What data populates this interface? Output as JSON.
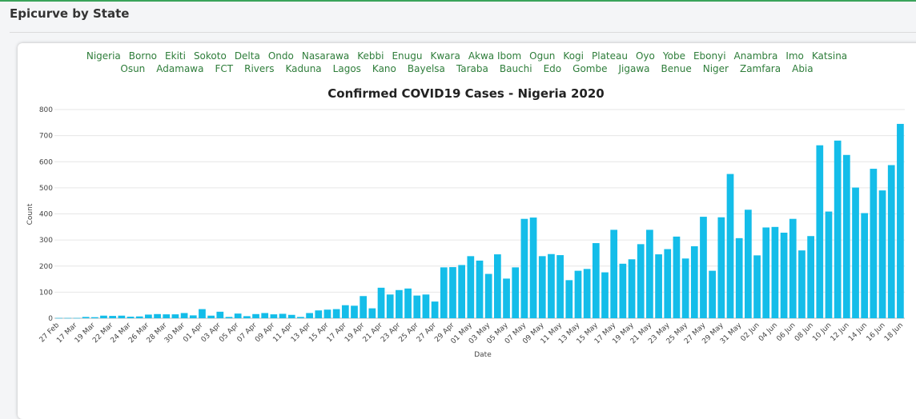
{
  "header": {
    "title": "Epicurve by State"
  },
  "state_filter": {
    "row1": [
      "Nigeria",
      "Borno",
      "Ekiti",
      "Sokoto",
      "Delta",
      "Ondo",
      "Nasarawa",
      "Kebbi",
      "Enugu",
      "Kwara",
      "Akwa Ibom",
      "Ogun",
      "Kogi",
      "Plateau",
      "Oyo",
      "Yobe",
      "Ebonyi",
      "Anambra",
      "Imo",
      "Katsina"
    ],
    "row2": [
      "Osun",
      "Adamawa",
      "FCT",
      "Rivers",
      "Kaduna",
      "Lagos",
      "Kano",
      "Bayelsa",
      "Taraba",
      "Bauchi",
      "Edo",
      "Gombe",
      "Jigawa",
      "Benue",
      "Niger",
      "Zamfara",
      "Abia"
    ]
  },
  "colors": {
    "bar": "#14bde9",
    "state_link": "#2e7d3a",
    "accent": "#3aa35a"
  },
  "chart_data": {
    "type": "bar",
    "title": "Confirmed COVID19 Cases - Nigeria 2020",
    "xlabel": "Date",
    "ylabel": "Count",
    "ylim": [
      0,
      800
    ],
    "yticks": [
      0,
      100,
      200,
      300,
      400,
      500,
      600,
      700,
      800
    ],
    "grid": true,
    "tick_labels": [
      "27 Feb",
      "17 Mar",
      "19 Mar",
      "22 Mar",
      "24 Mar",
      "26 Mar",
      "28 Mar",
      "30 Mar",
      "01 Apr",
      "03 Apr",
      "05 Apr",
      "07 Apr",
      "09 Apr",
      "11 Apr",
      "13 Apr",
      "15 Apr",
      "17 Apr",
      "19 Apr",
      "21 Apr",
      "23 Apr",
      "25 Apr",
      "27 Apr",
      "29 Apr",
      "01 May",
      "03 May",
      "05 May",
      "07 May",
      "09 May",
      "11 May",
      "13 May",
      "15 May",
      "17 May",
      "19 May",
      "21 May",
      "23 May",
      "25 May",
      "27 May",
      "29 May",
      "31 May",
      "02 Jun",
      "04 Jun",
      "06 Jun",
      "08 Jun",
      "10 Jun",
      "12 Jun",
      "14 Jun",
      "16 Jun",
      "18 Jun"
    ],
    "values": [
      1,
      1,
      1,
      5,
      4,
      10,
      9,
      10,
      6,
      7,
      14,
      16,
      15,
      15,
      20,
      11,
      35,
      10,
      25,
      5,
      18,
      8,
      16,
      20,
      15,
      17,
      13,
      5,
      20,
      30,
      33,
      35,
      50,
      48,
      85,
      38,
      117,
      91,
      108,
      114,
      87,
      91,
      64,
      195,
      196,
      204,
      238,
      221,
      170,
      245,
      152,
      195,
      381,
      386,
      238,
      246,
      242,
      146,
      182,
      189,
      288,
      176,
      339,
      209,
      226,
      284,
      339,
      245,
      265,
      313,
      229,
      276,
      389,
      182,
      387,
      553,
      307,
      416,
      241,
      348,
      350,
      328,
      381,
      260,
      315,
      663,
      409,
      681,
      626,
      501,
      403,
      573,
      490,
      587,
      745
    ]
  }
}
